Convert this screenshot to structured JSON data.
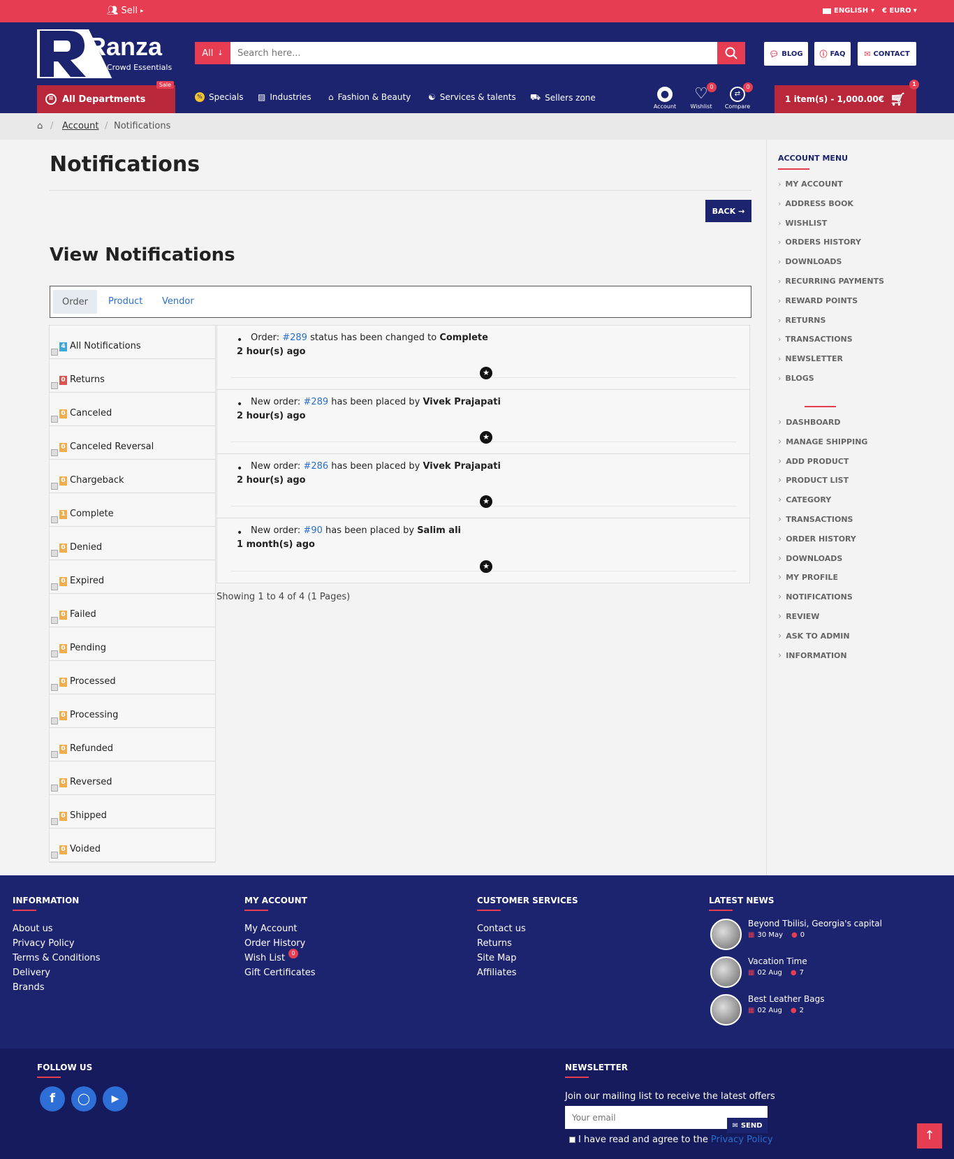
{
  "topbar": {
    "sell_label": "Sell",
    "language": "ENGLISH",
    "currency": "€ EURO"
  },
  "header": {
    "logo_text": "Ranza",
    "logo_tagline": "The Crowd Essentials",
    "search": {
      "category": "All",
      "placeholder": "Search here..."
    },
    "buttons": {
      "blog": "BLOG",
      "faq": "FAQ",
      "contact": "CONTACT"
    },
    "departments_label": "All Departments",
    "sale_badge": "Sale",
    "nav": [
      "Specials",
      "Industries",
      "Fashion & Beauty",
      "Services & talents",
      "Sellers zone"
    ],
    "icons": {
      "account": "Account",
      "wishlist": "Wishlist",
      "compare": "Compare",
      "wishlist_count": "0",
      "compare_count": "0"
    },
    "cart_label": "1 item(s) - 1,000.00€",
    "cart_count": "1"
  },
  "breadcrumb": {
    "account": "Account",
    "current": "Notifications"
  },
  "main": {
    "title": "Notifications",
    "back_label": "BACK",
    "subtitle": "View Notifications",
    "tabs": [
      "Order",
      "Product",
      "Vendor"
    ],
    "filters": [
      {
        "count": "4",
        "label": "All Notifications",
        "color": "#3fa7d6"
      },
      {
        "count": "0",
        "label": "Returns",
        "color": "#d9534f"
      },
      {
        "count": "0",
        "label": "Canceled",
        "color": "#f0ad4e"
      },
      {
        "count": "0",
        "label": "Canceled Reversal",
        "color": "#f0ad4e"
      },
      {
        "count": "0",
        "label": "Chargeback",
        "color": "#f0ad4e"
      },
      {
        "count": "1",
        "label": "Complete",
        "color": "#f0ad4e"
      },
      {
        "count": "0",
        "label": "Denied",
        "color": "#f0ad4e"
      },
      {
        "count": "0",
        "label": "Expired",
        "color": "#f0ad4e"
      },
      {
        "count": "0",
        "label": "Failed",
        "color": "#f0ad4e"
      },
      {
        "count": "0",
        "label": "Pending",
        "color": "#f0ad4e"
      },
      {
        "count": "0",
        "label": "Processed",
        "color": "#f0ad4e"
      },
      {
        "count": "0",
        "label": "Processing",
        "color": "#f0ad4e"
      },
      {
        "count": "0",
        "label": "Refunded",
        "color": "#f0ad4e"
      },
      {
        "count": "0",
        "label": "Reversed",
        "color": "#f0ad4e"
      },
      {
        "count": "0",
        "label": "Shipped",
        "color": "#f0ad4e"
      },
      {
        "count": "0",
        "label": "Voided",
        "color": "#f0ad4e"
      }
    ],
    "notifications": [
      {
        "prefix": "Order: ",
        "id": "#289",
        "mid": " status has been changed to ",
        "bold": "Complete",
        "time": "2 hour(s) ago"
      },
      {
        "prefix": "New order: ",
        "id": "#289",
        "mid": " has been placed by ",
        "bold": "Vivek Prajapati",
        "time": "2 hour(s) ago"
      },
      {
        "prefix": "New order: ",
        "id": "#286",
        "mid": " has been placed by ",
        "bold": "Vivek Prajapati",
        "time": "2 hour(s) ago"
      },
      {
        "prefix": "New order: ",
        "id": "#90",
        "mid": " has been placed by ",
        "bold": "Salim ali",
        "time": "1 month(s) ago"
      }
    ],
    "pagination": "Showing 1 to 4 of 4 (1 Pages)"
  },
  "account_menu": {
    "title": "ACCOUNT MENU",
    "items": [
      "MY ACCOUNT",
      "ADDRESS BOOK",
      "WISHLIST",
      "ORDERS HISTORY",
      "DOWNLOADS",
      "RECURRING PAYMENTS",
      "REWARD POINTS",
      "RETURNS",
      "TRANSACTIONS",
      "NEWSLETTER",
      "BLOGS"
    ],
    "seller_items": [
      "DASHBOARD",
      "MANAGE SHIPPING",
      "ADD PRODUCT",
      "PRODUCT LIST",
      "CATEGORY",
      "TRANSACTIONS",
      "ORDER HISTORY",
      "DOWNLOADS",
      "MY PROFILE",
      "NOTIFICATIONS",
      "REVIEW",
      "ASK TO ADMIN",
      "INFORMATION"
    ]
  },
  "footer": {
    "information": {
      "title": "INFORMATION",
      "links": [
        "About us",
        "Privacy Policy",
        "Terms & Conditions",
        "Delivery",
        "Brands"
      ]
    },
    "my_account": {
      "title": "MY ACCOUNT",
      "links": [
        "My Account",
        "Order History",
        "Wish List",
        "Gift Certificates"
      ],
      "wish_count": "0"
    },
    "customer_services": {
      "title": "CUSTOMER SERVICES",
      "links": [
        "Contact us",
        "Returns",
        "Site Map",
        "Affiliates"
      ]
    },
    "latest_news": {
      "title": "LATEST NEWS",
      "items": [
        {
          "title": "Beyond Tbilisi, Georgia's capital",
          "date": "30 May",
          "comments": "0"
        },
        {
          "title": "Vacation Time",
          "date": "02 Aug",
          "comments": "7"
        },
        {
          "title": "Best Leather Bags",
          "date": "02 Aug",
          "comments": "2"
        }
      ]
    },
    "follow_title": "FOLLOW US",
    "newsletter": {
      "title": "NEWSLETTER",
      "text": "Join our mailing list to receive the latest offers",
      "placeholder": "Your email",
      "send_label": "SEND",
      "agree_text": "I have read and agree to the",
      "policy_link": "Privacy Policy"
    }
  },
  "colors": {
    "primary": "#1c2470",
    "accent": "#e63d53",
    "link": "#2a6fcf"
  }
}
